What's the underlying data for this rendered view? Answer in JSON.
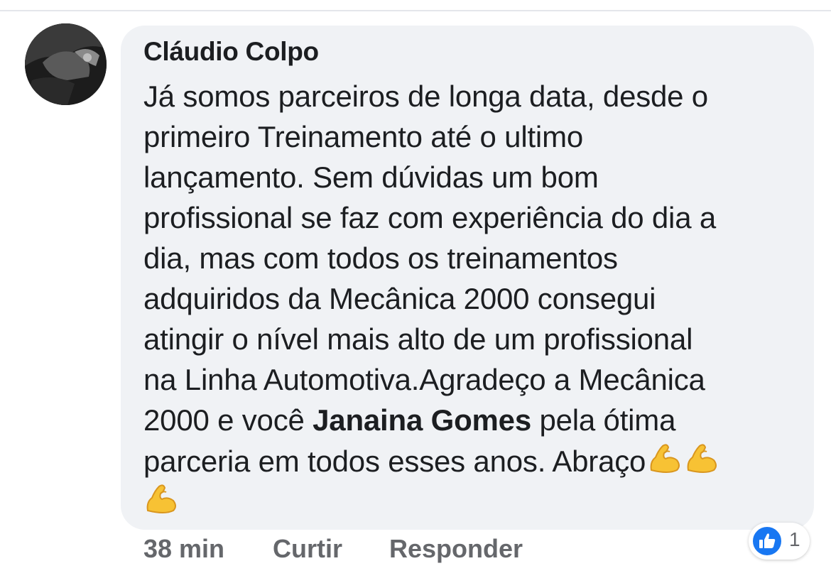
{
  "comment": {
    "author": "Cláudio Colpo",
    "lines": [
      "Já somos parceiros de longa data, desde o",
      "primeiro Treinamento até o ultimo",
      "lançamento. Sem dúvidas um bom",
      "profissional se faz com experiência do dia a",
      "dia, mas com todos os treinamentos",
      "adquiridos da Mecânica 2000 consegui",
      "atingir o nível mais alto de um profissional",
      "na Linha Automotiva.Agradeço a Mecânica"
    ],
    "line9_before": "2000 e você ",
    "mention": "Janaina Gomes",
    "line9_after": " pela ótima",
    "line10": "parceria em todos esses anos. Abraço",
    "emojis": [
      "flexed-biceps",
      "flexed-biceps",
      "flexed-biceps"
    ]
  },
  "actions": {
    "time": "38 min",
    "like_label": "Curtir",
    "reply_label": "Responder"
  },
  "reactions": {
    "icon": "like-icon",
    "count": "1",
    "color": "#1877f2"
  },
  "colors": {
    "bubble": "#f0f2f5",
    "text": "#1c1e21",
    "secondary": "#65676b"
  }
}
